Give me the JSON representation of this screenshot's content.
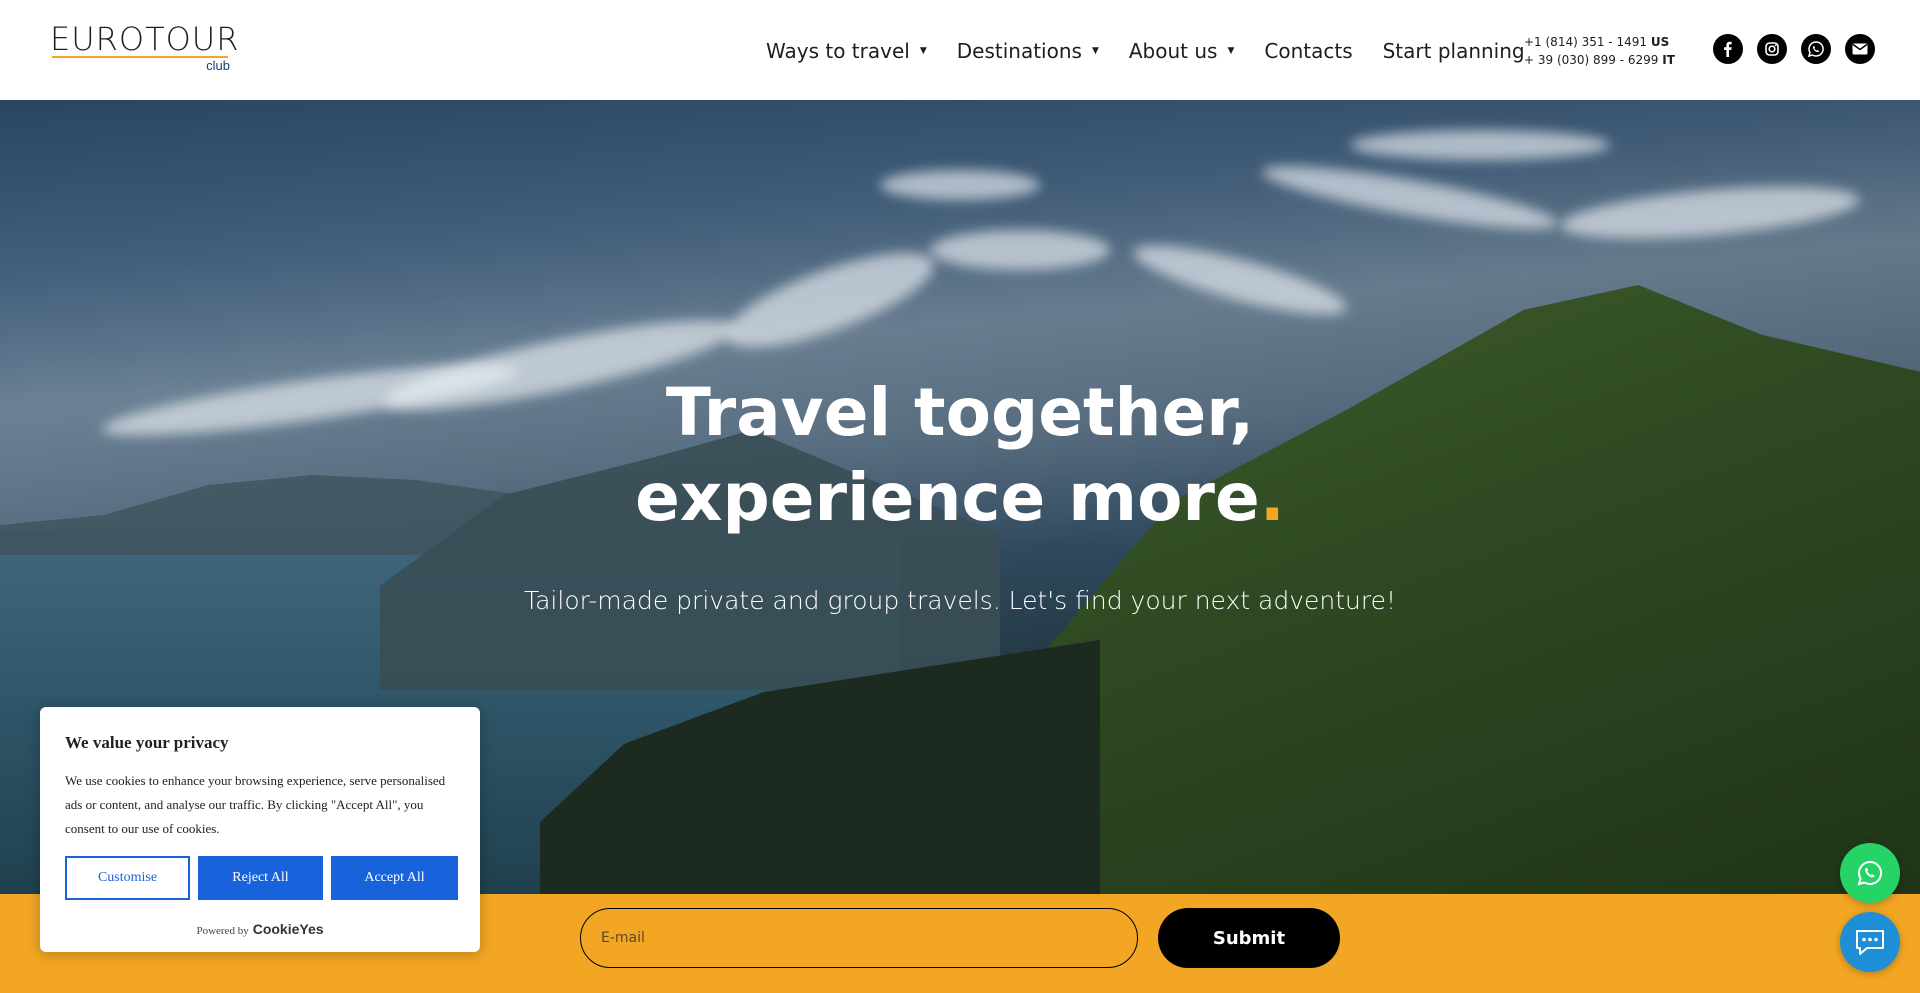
{
  "header": {
    "logo_text": "EUROTOUR",
    "logo_sub": "club",
    "nav": [
      {
        "label": "Ways to travel",
        "has_dropdown": true
      },
      {
        "label": "Destinations",
        "has_dropdown": true
      },
      {
        "label": "About us",
        "has_dropdown": true
      },
      {
        "label": "Contacts",
        "has_dropdown": false
      },
      {
        "label": "Start planning",
        "has_dropdown": false
      }
    ],
    "phones": [
      {
        "number": "+1 (814) 351 - 1491",
        "country": "US"
      },
      {
        "number": "+ 39 (030) 899 - 6299",
        "country": "IT"
      }
    ],
    "socials": [
      "facebook-icon",
      "instagram-icon",
      "whatsapp-icon",
      "mail-icon"
    ]
  },
  "hero": {
    "title_main": "Travel together, experience more",
    "title_dot": ".",
    "subtitle": "Tailor-made private and group travels. Let's find your next adventure!"
  },
  "newsletter": {
    "email_placeholder": "E-mail",
    "submit_label": "Submit"
  },
  "cookie": {
    "title": "We value your privacy",
    "text": "We use cookies to enhance your browsing experience, serve personalised ads or content, and analyse our traffic. By clicking \"Accept All\", you consent to our use of cookies.",
    "customise_label": "Customise",
    "reject_label": "Reject All",
    "accept_label": "Accept All",
    "powered_by": "Powered by",
    "brand": "CookieYes"
  },
  "floating": {
    "whatsapp": "whatsapp-icon",
    "chat": "chat-icon"
  },
  "colors": {
    "accent": "#f3a623",
    "cookie_blue": "#1863dc",
    "whatsapp_green": "#25d366",
    "chat_blue": "#1e8fd6"
  }
}
